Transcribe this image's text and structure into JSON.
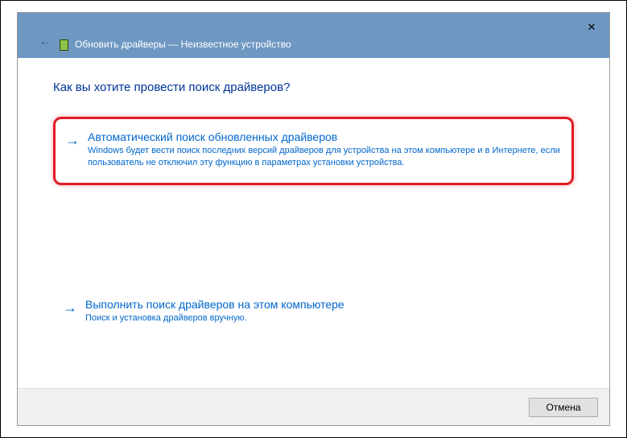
{
  "titlebar": {
    "title": "Обновить драйверы — Неизвестное устройство"
  },
  "content": {
    "heading": "Как вы хотите провести поиск драйверов?",
    "option1": {
      "title": "Автоматический поиск обновленных драйверов",
      "description": "Windows будет вести поиск последних версий драйверов для устройства на этом компьютере и в Интернете, если пользователь не отключил эту функцию в параметрах установки устройства."
    },
    "option2": {
      "title": "Выполнить поиск драйверов на этом компьютере",
      "description": "Поиск и установка драйверов вручную."
    }
  },
  "footer": {
    "cancel_label": "Отмена"
  }
}
